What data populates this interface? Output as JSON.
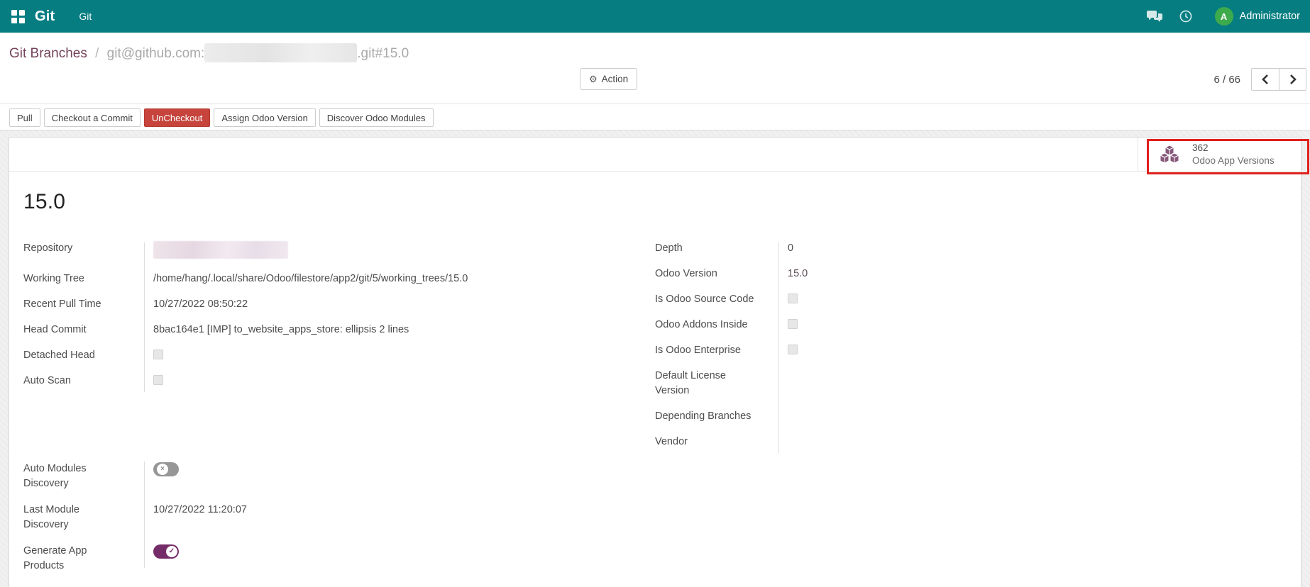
{
  "navbar": {
    "brand": "Git",
    "menu_item": "Git",
    "user_name": "Administrator",
    "avatar_letter": "A",
    "colors": {
      "bar_bg": "#067d81",
      "avatar_bg": "#3dab4b"
    }
  },
  "breadcrumb": {
    "current": "Git Branches",
    "separator": "/",
    "muted_prefix": "git@github.com:",
    "muted_suffix": ".git#15.0",
    "redacted": true
  },
  "control_panel": {
    "action_label": "Action",
    "pager_value": "6 / 66"
  },
  "workflow_buttons": [
    {
      "label": "Pull",
      "active": false
    },
    {
      "label": "Checkout a Commit",
      "active": false
    },
    {
      "label": "UnCheckout",
      "active": true,
      "color": "#c6443c"
    },
    {
      "label": "Assign Odoo Version",
      "active": false
    },
    {
      "label": "Discover Odoo Modules",
      "active": false
    }
  ],
  "stat_button": {
    "count": "362",
    "label": "Odoo App Versions",
    "icon": "cubes-icon",
    "icon_color": "#875a7b",
    "highlight_color": "#e0201d"
  },
  "sheet": {
    "title": "15.0",
    "fields_left": [
      {
        "label": "Repository",
        "type": "redacted",
        "value": ""
      },
      {
        "label": "Working Tree",
        "type": "text",
        "value": "/home/hang/.local/share/Odoo/filestore/app2/git/5/working_trees/15.0"
      },
      {
        "label": "Recent Pull Time",
        "type": "text",
        "value": "10/27/2022 08:50:22"
      },
      {
        "label": "Head Commit",
        "type": "text",
        "value": "8bac164e1 [IMP] to_website_apps_store: ellipsis 2 lines"
      },
      {
        "label": "Detached Head",
        "type": "checkbox",
        "checked": false
      },
      {
        "label": "Auto Scan",
        "type": "checkbox",
        "checked": false
      }
    ],
    "fields_right": [
      {
        "label": "Depth",
        "type": "text",
        "value": "0"
      },
      {
        "label": "Odoo Version",
        "type": "text",
        "value": "15.0"
      },
      {
        "label": "Is Odoo Source Code",
        "type": "checkbox",
        "checked": false
      },
      {
        "label": "Odoo Addons Inside",
        "type": "checkbox",
        "checked": false
      },
      {
        "label": "Is Odoo Enterprise",
        "type": "checkbox",
        "checked": false
      },
      {
        "label": "Default License Version",
        "type": "empty",
        "value": ""
      },
      {
        "label": "Depending Branches",
        "type": "empty",
        "value": ""
      },
      {
        "label": "Vendor",
        "type": "empty",
        "value": ""
      }
    ],
    "fields_bottom": [
      {
        "label": "Auto Modules Discovery",
        "type": "toggle",
        "checked": false
      },
      {
        "label": "Last Module Discovery",
        "type": "text",
        "value": "10/27/2022 11:20:07"
      },
      {
        "label": "Generate App Products",
        "type": "toggle",
        "checked": true,
        "toggle_on_color": "#752d6a"
      }
    ]
  }
}
